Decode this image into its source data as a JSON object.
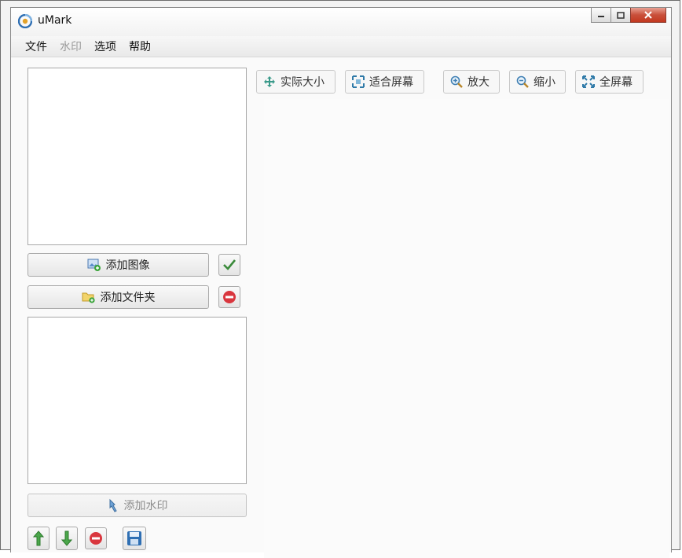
{
  "window": {
    "title": "uMark",
    "buttons": {
      "minimize": "minimize",
      "maximize": "maximize",
      "close": "close"
    }
  },
  "menu": [
    {
      "label": "文件",
      "enabled": true
    },
    {
      "label": "水印",
      "enabled": false
    },
    {
      "label": "选项",
      "enabled": true
    },
    {
      "label": "帮助",
      "enabled": true
    }
  ],
  "toolbar": {
    "actual_size": "实际大小",
    "fit_screen": "适合屏幕",
    "zoom_in": "放大",
    "zoom_out": "缩小",
    "full_screen": "全屏幕"
  },
  "images": {
    "add_image": "添加图像",
    "add_folder": "添加文件夹"
  },
  "watermarks": {
    "add_watermark": "添加水印"
  },
  "colors": {
    "accent_blue": "#2f6fb3",
    "confirm_green": "#3a8a3a",
    "remove_red": "#d9363e"
  }
}
